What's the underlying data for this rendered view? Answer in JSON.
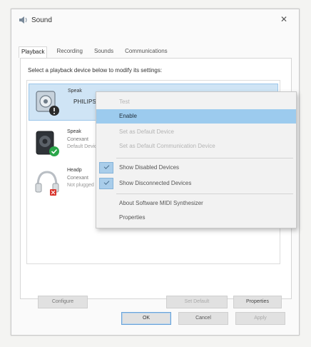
{
  "window": {
    "title": "Sound",
    "close_glyph": "✕"
  },
  "tabs": [
    {
      "label": "Playback"
    },
    {
      "label": "Recording"
    },
    {
      "label": "Sounds"
    },
    {
      "label": "Communications"
    }
  ],
  "instruction": "Select a playback device below to modify its settings:",
  "devices": [
    {
      "name": "Speak",
      "brand": "PHILIPS",
      "sub": "",
      "sub2": "",
      "status": "disabled",
      "icon": "monitor-speaker-icon"
    },
    {
      "name": "Speak",
      "sub": "Conexant",
      "sub2": "Default Device",
      "status": "default",
      "icon": "speaker-icon"
    },
    {
      "name": "Headp",
      "sub": "Conexant",
      "sub2": "Not plugged in",
      "status": "unplugged",
      "icon": "headphones-icon"
    }
  ],
  "context_menu": {
    "items": [
      {
        "label": "Test",
        "state": "disabled"
      },
      {
        "label": "Enable",
        "state": "highlight"
      },
      {
        "label": "Set as Default Device",
        "state": "disabled"
      },
      {
        "label": "Set as Default Communication Device",
        "state": "disabled"
      },
      {
        "label": "Show Disabled Devices",
        "state": "checked"
      },
      {
        "label": "Show Disconnected Devices",
        "state": "checked"
      },
      {
        "label": "About Software MIDI Synthesizer",
        "state": "normal"
      },
      {
        "label": "Properties",
        "state": "normal"
      }
    ]
  },
  "panel_buttons": {
    "configure": "Configure",
    "set_default": "Set Default",
    "properties": "Properties"
  },
  "footer_buttons": {
    "ok": "OK",
    "cancel": "Cancel",
    "apply": "Apply"
  },
  "colors": {
    "highlight": "#9ccbee",
    "selected_row": "#cfe4f5",
    "status_green": "#2aa64a",
    "status_red": "#d8322a"
  }
}
